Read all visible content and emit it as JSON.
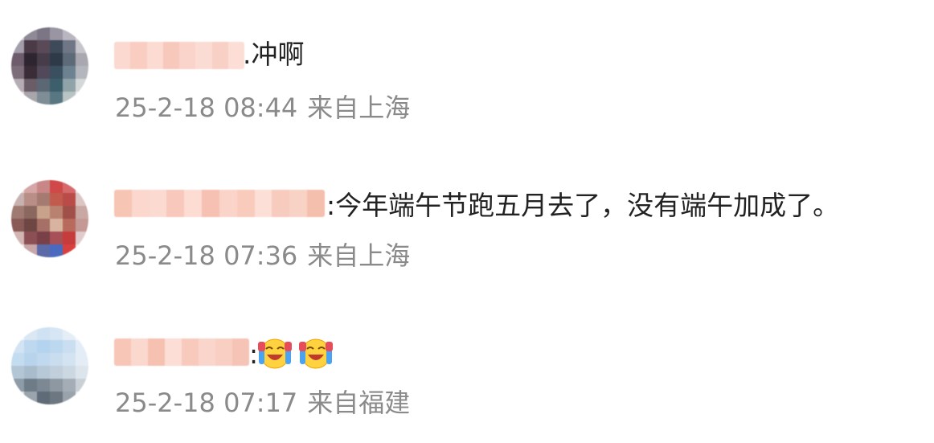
{
  "comments": [
    {
      "text": ".冲啊",
      "time": "25-2-18 08:44",
      "location": "来自上海"
    },
    {
      "text": ":今年端午节跑五月去了，没有端午加成了。",
      "time": "25-2-18 07:36",
      "location": "来自上海"
    },
    {
      "text": ":",
      "emojis": [
        "laughing-crying-emoji",
        "laughing-crying-emoji"
      ],
      "time": "25-2-18 07:17",
      "location": "来自福建"
    }
  ],
  "colors": {
    "text": "#222222",
    "meta": "#8a8a8a",
    "name_blur": "#f6c8bd"
  }
}
